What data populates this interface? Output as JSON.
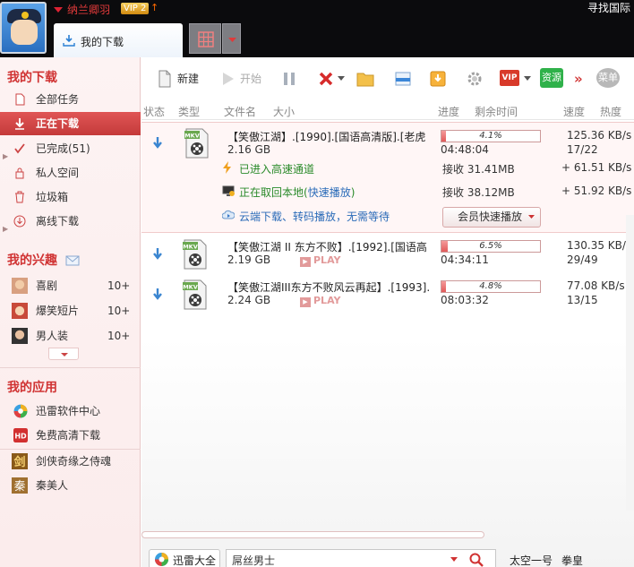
{
  "header": {
    "username": "纳兰卿羽",
    "vip_level": "VIP 2",
    "top_right_text": "寻找国际",
    "tab_label": "我的下载"
  },
  "sidebar": {
    "sec_download": "我的下载",
    "items": [
      {
        "label": "全部任务",
        "count": ""
      },
      {
        "label": "正在下载",
        "count": ""
      },
      {
        "label": "已完成(51)",
        "count": ""
      },
      {
        "label": "私人空间",
        "count": ""
      },
      {
        "label": "垃圾箱",
        "count": ""
      },
      {
        "label": "离线下载",
        "count": ""
      }
    ],
    "sec_interest": "我的兴趣",
    "interests": [
      {
        "label": "喜剧",
        "count": "10+"
      },
      {
        "label": "爆笑短片",
        "count": "10+"
      },
      {
        "label": "男人装",
        "count": "10+"
      }
    ],
    "sec_apps": "我的应用",
    "apps": [
      {
        "label": "迅雷软件中心"
      },
      {
        "label": "免费高清下载"
      },
      {
        "label": "剑侠奇缘之侍魂"
      },
      {
        "label": "秦美人"
      }
    ]
  },
  "toolbar": {
    "new": "新建",
    "start": "开始",
    "more": "»",
    "vip": "VIP",
    "resource": "资源",
    "menu": "菜单"
  },
  "columns": {
    "status": "状态",
    "type": "类型",
    "filename": "文件名",
    "size": "大小",
    "progress": "进度",
    "remaining": "剩余时间",
    "speed": "速度",
    "heat": "热度"
  },
  "tasks": [
    {
      "name": "【笑傲江湖】.[1990].[国语高清版].[老虎",
      "size": "2.16 GB",
      "progress_pct": 4.1,
      "progress_label": "4.1%",
      "remaining": "04:48:04",
      "speed": "125.36 KB/s",
      "heat": "17/22",
      "file_type": "MKV",
      "sub_lines": {
        "high_speed": "已进入高速通道",
        "local_fetch": "正在取回本地(",
        "fast_play": "快速播放",
        "local_fetch_end": ")",
        "cloud": "云端下载、转码播放，无需等待",
        "recv1": "接收 31.41MB",
        "recv2": "接收 38.12MB",
        "speed1": "+ 61.51 KB/s",
        "speed2": "+ 51.92 KB/s",
        "member_button": "会员快速播放"
      }
    },
    {
      "name": "【笑傲江湖 II 东方不败】.[1992].[国语高",
      "size": "2.19 GB",
      "progress_pct": 6.5,
      "progress_label": "6.5%",
      "remaining": "04:34:11",
      "speed": "130.35 KB/s",
      "heat": "29/49",
      "file_type": "MKV",
      "play": "PLAY"
    },
    {
      "name": "【笑傲江湖III东方不败风云再起】.[1993].",
      "size": "2.24 GB",
      "progress_pct": 4.8,
      "progress_label": "4.8%",
      "remaining": "08:03:32",
      "speed": "77.08 KB/s",
      "heat": "13/15",
      "file_type": "MKV",
      "play": "PLAY"
    }
  ],
  "bottom": {
    "xl_button": "迅雷大全",
    "search_value": "屌丝男士",
    "hot1": "太空一号",
    "hot2": "拳皇"
  },
  "colors": {
    "accent_red": "#d03232",
    "progress_fill": "#e25a5a",
    "green_text": "#2a8a2a",
    "blue_text": "#2a6bb8"
  }
}
